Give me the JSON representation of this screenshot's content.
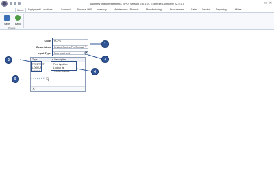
{
  "window": {
    "title": "Add new custom element - BPO: Version 2.5.0.9 - Example Company v2.5.0.0",
    "minimize_glyph": "–",
    "maximize_glyph": "□",
    "close_glyph": "✕"
  },
  "ribbon": {
    "tabs": [
      "Home",
      "Equipment / Locations",
      "Contract",
      "Finance / HR",
      "Inventory",
      "Maintenance / Projects",
      "Manufacturing",
      "Procurement",
      "Sales",
      "Service",
      "Reporting",
      "Utilities"
    ],
    "active_tab": "Home",
    "buttons": [
      {
        "label": "Save",
        "icon": "save-icon"
      },
      {
        "label": "Back",
        "icon": "back-icon"
      }
    ],
    "group_label": "Process"
  },
  "form": {
    "code": {
      "label": "Code",
      "value": "PCPS"
    },
    "description": {
      "label": "Description",
      "value": "Printed Copies Per Second"
    },
    "input_type": {
      "label": "Input Type",
      "value": "Free input text"
    },
    "required_marker": "*"
  },
  "dropdown": {
    "columns": [
      "Type",
      "Description"
    ],
    "rows": [
      {
        "type": "FREETEXT",
        "description": "Free input text"
      },
      {
        "type": "LOOKUP",
        "description": "Lookup list"
      },
      {
        "type": "YESNO",
        "description": "Yes or No value"
      }
    ],
    "close_glyph": "✕"
  },
  "annotations": [
    "1",
    "2",
    "3",
    "4",
    "5"
  ],
  "colors": {
    "annotation": "#2f5597",
    "ribbon_bg": "#f6f8fb",
    "border": "#b7c3d3"
  }
}
